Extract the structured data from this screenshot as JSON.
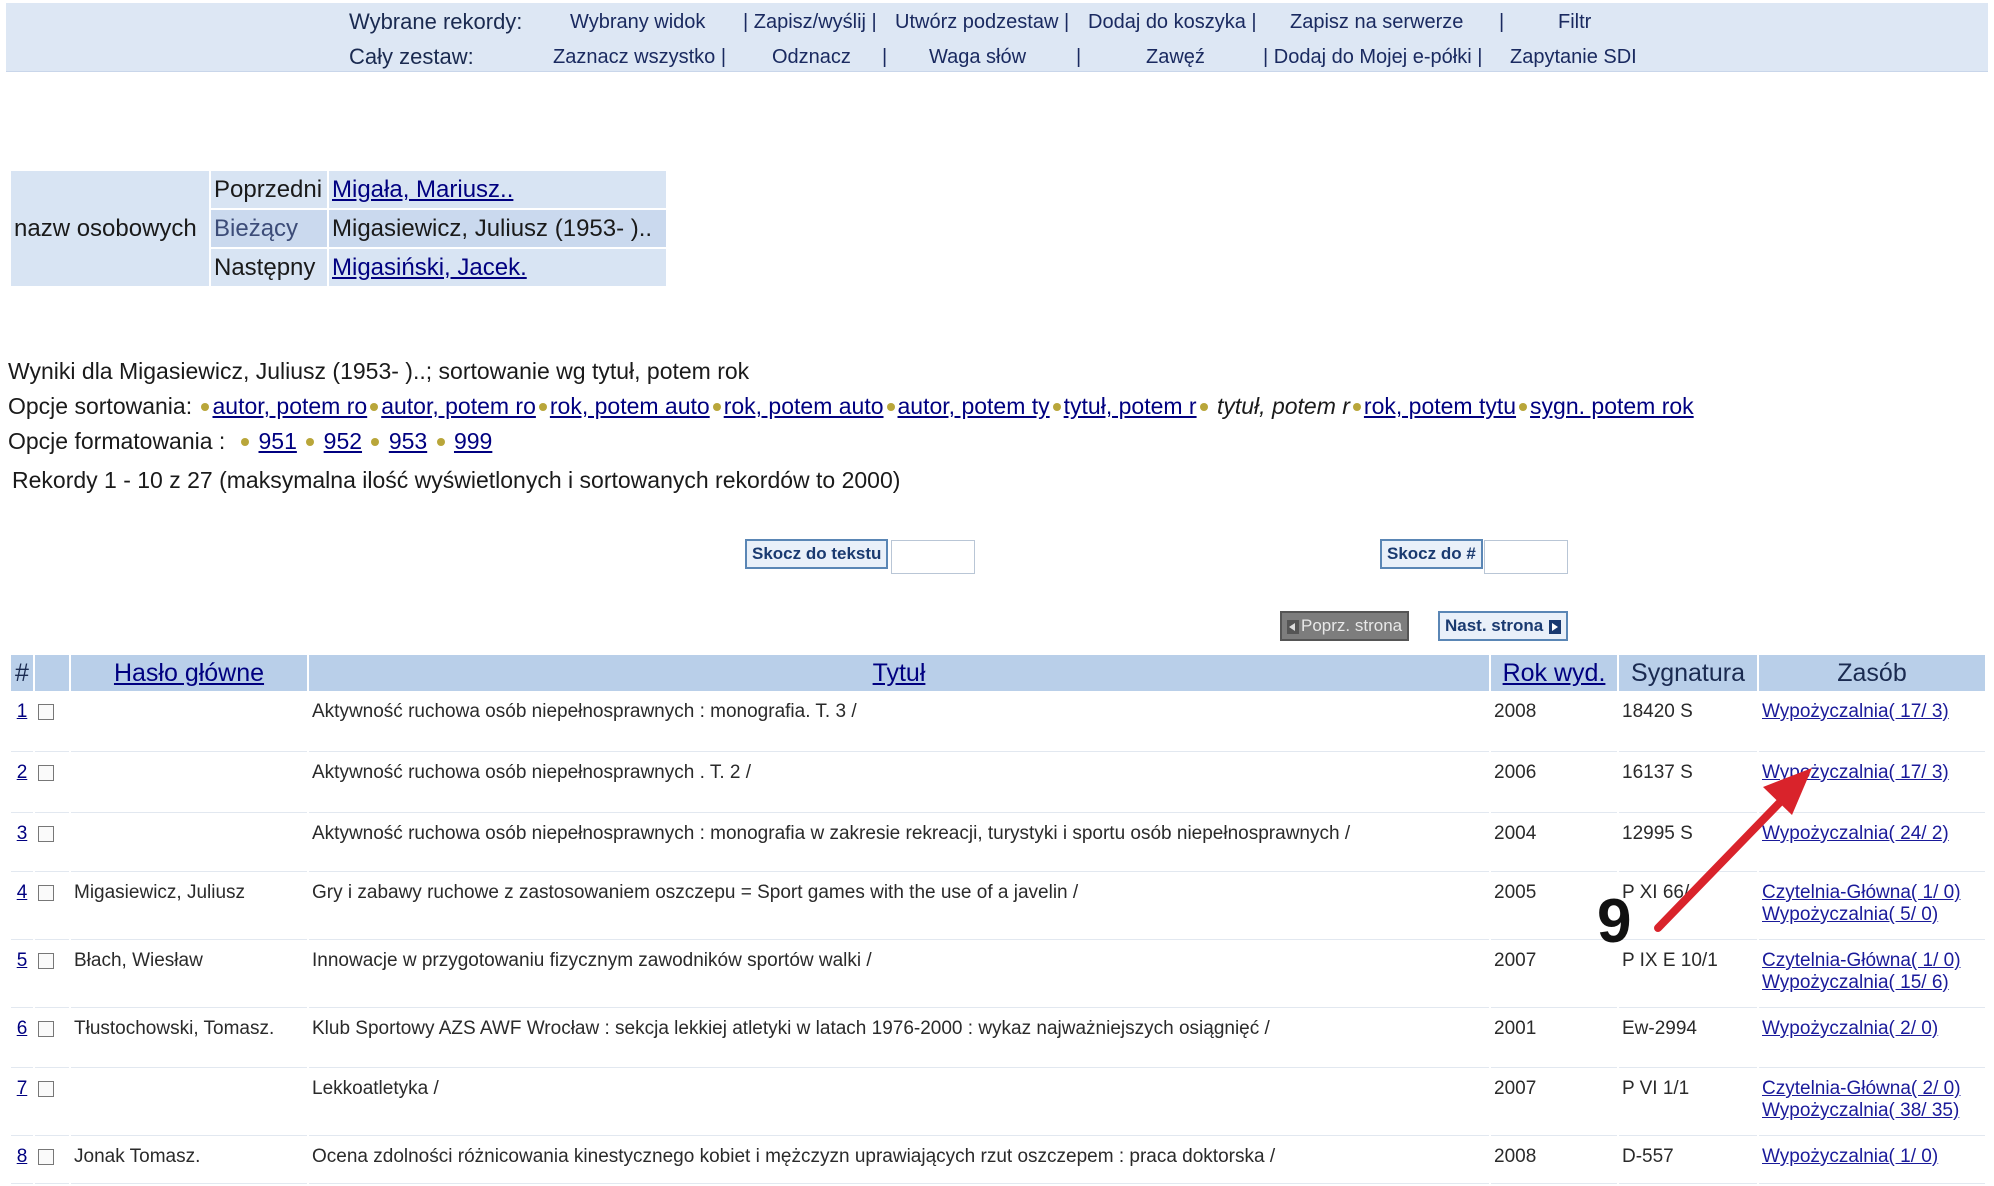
{
  "menu": {
    "row1_label": "Wybrane rekordy:",
    "row1_items": [
      "Wybrany widok",
      "| Zapisz/wyślij |",
      "Utwórz podzestaw |",
      "Dodaj do koszyka |",
      "Zapisz na serwerze",
      "|",
      "Filtr"
    ],
    "row2_label": "Cały zestaw:",
    "row2_items": [
      "Zaznacz wszystko |",
      "Odznacz",
      "|",
      "Waga słów",
      "|",
      "Zawęź",
      "| Dodaj do Mojej e-półki |",
      "Zapytanie SDI"
    ]
  },
  "browse": {
    "index_label": "nazw osobowych",
    "prev_label": "Poprzedni",
    "prev_value": "Migała, Mariusz..",
    "cur_label": "Bieżący",
    "cur_value": "Migasiewicz, Juliusz (1953- )..",
    "next_label": "Następny",
    "next_value": "Migasiński, Jacek."
  },
  "info": {
    "results_for": "Wyniki dla Migasiewicz, Juliusz (1953- )..; sortowanie wg tytuł, potem rok",
    "sort_label": "Opcje sortowania:",
    "sort_options": [
      "autor, potem ro",
      "autor, potem ro",
      "rok, potem auto",
      "rok, potem auto",
      "autor, potem ty",
      "tytuł, potem r",
      "tytuł, potem r",
      "rok, potem tytu",
      "sygn. potem rok"
    ],
    "format_label": "Opcje formatowania :",
    "format_options": [
      "951",
      "952",
      "953",
      "999"
    ],
    "records": "Rekordy 1 - 10 z 27 (maksymalna ilość wyświetlonych i sortowanych rekordów to 2000)"
  },
  "controls": {
    "jump_text": "Skocz do tekstu",
    "jump_num": "Skocz do #",
    "prev_page": "Poprz. strona",
    "next_page": "Nast. strona"
  },
  "table": {
    "headers": [
      "#",
      "",
      "Hasło główne",
      "Tytuł",
      "Rok wyd.",
      "Sygnatura",
      "Zasób"
    ],
    "rows": [
      {
        "n": "1",
        "author": "",
        "title": "Aktywność ruchowa osób niepełnosprawnych : monografia. T. 3 /",
        "year": "2008",
        "sig": "18420 S",
        "z1": "Wypożyczalnia( 17/ 3)",
        "z2": ""
      },
      {
        "n": "2",
        "author": "",
        "title": "Aktywność ruchowa osób niepełnosprawnych . T. 2 /",
        "year": "2006",
        "sig": "16137 S",
        "z1": "Wypożyczalnia( 17/ 3)",
        "z2": ""
      },
      {
        "n": "3",
        "author": "",
        "title": "Aktywność ruchowa osób niepełnosprawnych : monografia w zakresie rekreacji, turystyki i sportu osób niepełnosprawnych /",
        "year": "2004",
        "sig": "12995 S",
        "z1": "Wypożyczalnia( 24/ 2)",
        "z2": ""
      },
      {
        "n": "4",
        "author": "Migasiewicz, Juliusz",
        "title": "Gry i zabawy ruchowe z zastosowaniem oszczepu = Sport games with the use of a javelin /",
        "year": "2005",
        "sig": "P XI 66/",
        "z1": "Czytelnia-Główna( 1/ 0)",
        "z2": "Wypożyczalnia( 5/ 0)"
      },
      {
        "n": "5",
        "author": "Błach, Wiesław",
        "title": "Innowacje w przygotowaniu fizycznym zawodników sportów walki /",
        "year": "2007",
        "sig": "P IX E 10/1",
        "z1": "Czytelnia-Główna( 1/ 0)",
        "z2": "Wypożyczalnia( 15/ 6)"
      },
      {
        "n": "6",
        "author": "Tłustochowski, Tomasz.",
        "title": "Klub Sportowy AZS AWF Wrocław : sekcja lekkiej atletyki w latach 1976-2000 : wykaz najważniejszych osiągnięć /",
        "year": "2001",
        "sig": "Ew-2994",
        "z1": "Wypożyczalnia( 2/ 0)",
        "z2": ""
      },
      {
        "n": "7",
        "author": "",
        "title": "Lekkoatletyka /",
        "year": "2007",
        "sig": "P VI 1/1",
        "z1": "Czytelnia-Główna( 2/ 0)",
        "z2": "Wypożyczalnia( 38/ 35)"
      },
      {
        "n": "8",
        "author": "Jonak Tomasz.",
        "title": "Ocena zdolności różnicowania kinestycznego kobiet i mężczyzn uprawiających rzut oszczepem : praca doktorska /",
        "year": "2008",
        "sig": "D-557",
        "z1": "Wypożyczalnia( 1/ 0)",
        "z2": ""
      }
    ]
  },
  "annotation": {
    "label": "9",
    "color": "#d9232b"
  }
}
